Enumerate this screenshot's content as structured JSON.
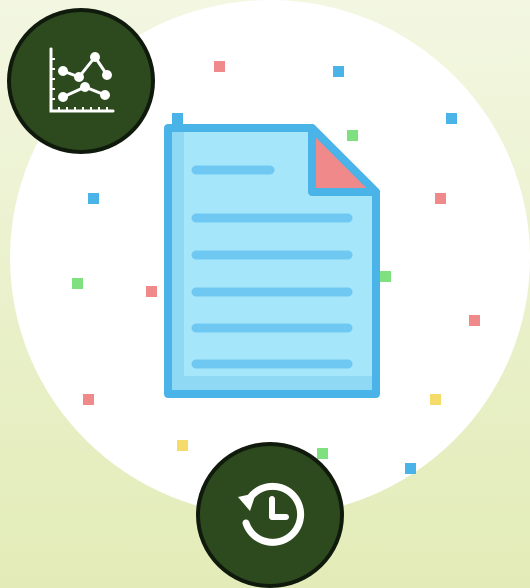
{
  "colors": {
    "background": "#eef3d4",
    "circle": "#ffffff",
    "button_fill": "#2c4a1e",
    "button_border": "#101a0c",
    "doc_fill": "#a6e6fb",
    "doc_stroke": "#4ab3e8",
    "doc_fold": "#f08a8a",
    "confetti": [
      "#f08a8a",
      "#4ab3e8",
      "#7fe07f",
      "#f5dc6a"
    ]
  },
  "illustration": {
    "icon": "document-icon"
  },
  "buttons": {
    "chart": {
      "icon": "line-chart-icon"
    },
    "history": {
      "icon": "history-icon"
    }
  }
}
